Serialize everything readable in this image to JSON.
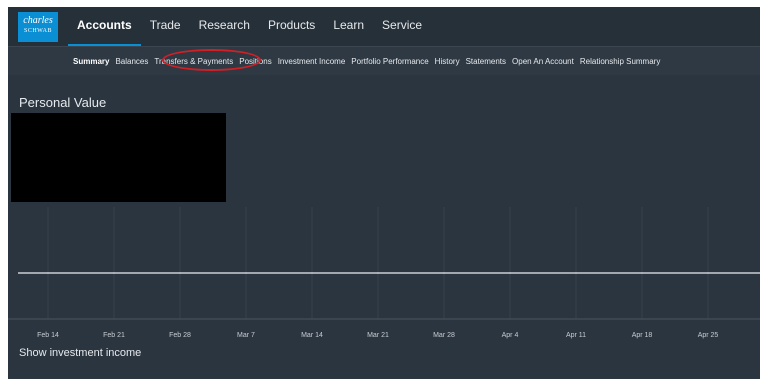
{
  "logo": {
    "line1": "charles",
    "line2": "SCHWAB"
  },
  "main_nav": {
    "items": [
      {
        "label": "Accounts",
        "active": true
      },
      {
        "label": "Trade"
      },
      {
        "label": "Research"
      },
      {
        "label": "Products"
      },
      {
        "label": "Learn"
      },
      {
        "label": "Service"
      }
    ]
  },
  "sub_nav": {
    "items": [
      {
        "label": "Summary",
        "active": true
      },
      {
        "label": "Balances"
      },
      {
        "label": "Transfers & Payments",
        "highlighted": true
      },
      {
        "label": "Positions"
      },
      {
        "label": "Investment Income"
      },
      {
        "label": "Portfolio Performance"
      },
      {
        "label": "History"
      },
      {
        "label": "Statements"
      },
      {
        "label": "Open An Account"
      },
      {
        "label": "Relationship Summary"
      }
    ]
  },
  "main": {
    "title": "Personal Value",
    "show_income_link": "Show investment income"
  },
  "colors": {
    "background": "#2b3540",
    "nav_background": "#263039",
    "accent": "#0a8fd4",
    "highlight_circle": "#d21f26",
    "chart_line": "#c9ced3"
  },
  "chart_data": {
    "type": "line",
    "x": [
      "Feb 14",
      "Feb 21",
      "Feb 28",
      "Mar 7",
      "Mar 14",
      "Mar 21",
      "Mar 28",
      "Apr 4",
      "Apr 11",
      "Apr 18",
      "Apr 25"
    ],
    "series": [
      {
        "values": [
          0,
          0,
          0,
          0,
          0,
          0,
          0,
          0,
          0,
          0,
          0
        ]
      }
    ],
    "title": "Personal Value",
    "grid": true
  }
}
